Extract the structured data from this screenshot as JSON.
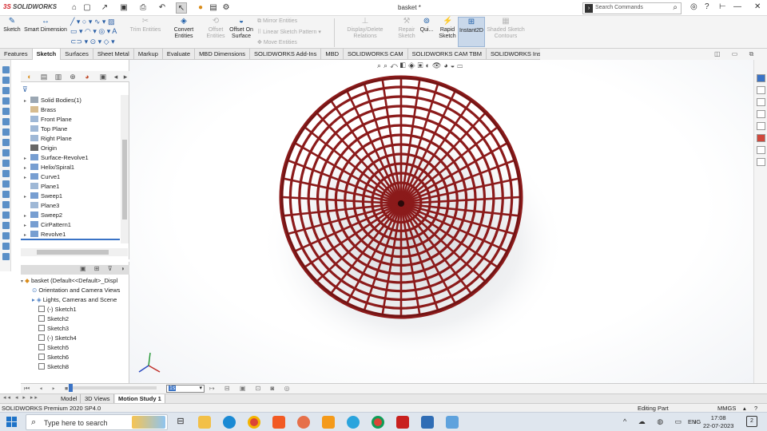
{
  "app": {
    "logo_prefix": "3S",
    "logo_brand": "SOLIDWORKS",
    "doc_title": "basket *"
  },
  "title_bar": {
    "search_placeholder": "Search Commands",
    "buttons": [
      "home-icon",
      "new-icon",
      "open-icon",
      "save-icon",
      "print-icon",
      "undo-icon",
      "select-icon",
      "rebuild-icon",
      "file-props-icon",
      "options-icon"
    ]
  },
  "ribbon": {
    "sketch": "Sketch",
    "smart_dimension": "Smart Dimension",
    "trim_entities": "Trim Entities",
    "convert_entities": "Convert Entities",
    "offset_entities_1": "Offset",
    "offset_entities_2": "Entities",
    "offset_on_surface_1": "Offset On",
    "offset_on_surface_2": "Surface",
    "mirror_entities": "Mirror Entities",
    "linear_sketch_pattern": "Linear Sketch Pattern",
    "move_entities": "Move Entities",
    "display_delete_relations": "Display/Delete Relations",
    "repair_sketch_1": "Repair",
    "repair_sketch_2": "Sketch",
    "quick_snaps": "Qui...",
    "rapid_sketch_1": "Rapid",
    "rapid_sketch_2": "Sketch",
    "instant2d": "Instant2D",
    "shaded_sketch_contours_1": "Shaded Sketch",
    "shaded_sketch_contours_2": "Contours"
  },
  "tabs": [
    "Features",
    "Sketch",
    "Surfaces",
    "Sheet Metal",
    "Markup",
    "Evaluate",
    "MBD Dimensions",
    "SOLIDWORKS Add-Ins",
    "MBD",
    "SOLIDWORKS CAM",
    "SOLIDWORKS CAM TBM",
    "SOLIDWORKS Inspection"
  ],
  "active_tab": "Sketch",
  "feature_tree": [
    {
      "label": "Solid Bodies(1)",
      "expand": true
    },
    {
      "label": "Brass",
      "expand": false
    },
    {
      "label": "Front Plane",
      "expand": false
    },
    {
      "label": "Top Plane",
      "expand": false
    },
    {
      "label": "Right Plane",
      "expand": false
    },
    {
      "label": "Origin",
      "expand": false
    },
    {
      "label": "Surface-Revolve1",
      "expand": true
    },
    {
      "label": "Helix/Spiral1",
      "expand": true
    },
    {
      "label": "Curve1",
      "expand": true
    },
    {
      "label": "Plane1",
      "expand": false
    },
    {
      "label": "Sweep1",
      "expand": true
    },
    {
      "label": "Plane3",
      "expand": false
    },
    {
      "label": "Sweep2",
      "expand": true
    },
    {
      "label": "CirPattern1",
      "expand": true
    },
    {
      "label": "Revolve1",
      "expand": true
    }
  ],
  "display_manager": {
    "root": "basket  (Default<<Default>_Displ",
    "items": [
      "Orientation and Camera Views",
      "Lights, Cameras and Scene",
      "(-) Sketch1",
      "Sketch2",
      "Sketch3",
      "(-) Sketch4",
      "Sketch5",
      "Sketch6",
      "Sketch8"
    ]
  },
  "motion": {
    "time_value": "1s"
  },
  "bottom_tabs": [
    "Model",
    "3D Views",
    "Motion Study 1"
  ],
  "active_bottom_tab": "Motion Study 1",
  "status": {
    "version": "SOLIDWORKS Premium 2020 SP4.0",
    "mode": "Editing Part",
    "units": "MMGS"
  },
  "taskbar": {
    "search_placeholder": "Type here to search",
    "lang": "ENG",
    "time": "17:08",
    "date": "22-07-2023",
    "notifications": "2"
  },
  "colors": {
    "basket": "#8b1a1a",
    "accent": "#1e73c8",
    "brand_red": "#d2232a"
  }
}
